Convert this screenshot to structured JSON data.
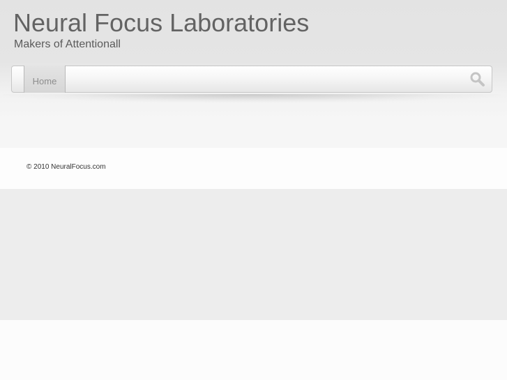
{
  "site": {
    "title": "Neural Focus Laboratories",
    "tagline": "Makers of Attentionall"
  },
  "nav": {
    "items": [
      {
        "label": "Home",
        "active": true
      }
    ],
    "search_icon": "search-icon"
  },
  "footer": {
    "copyright": "© 2010 NeuralFocus.com"
  },
  "colors": {
    "title": "#636363",
    "header_bg": "#e4e4e4",
    "gray_band": "#ededed"
  }
}
